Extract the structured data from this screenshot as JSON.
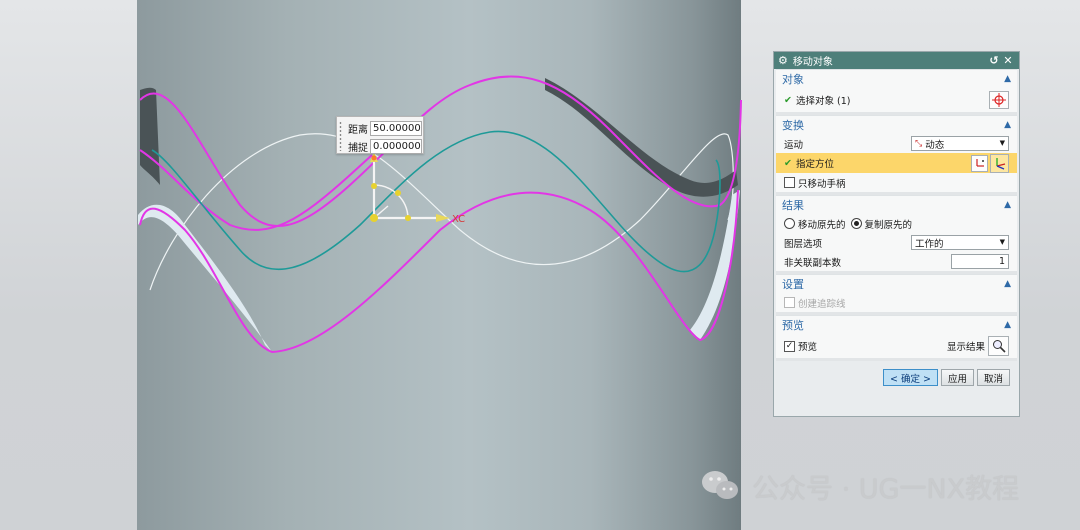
{
  "dynamic_input": {
    "distance_label": "距离",
    "distance_value": "50.000000",
    "snap_label": "捕捉",
    "snap_value": "0.000000"
  },
  "triad": {
    "axis_label": "XC"
  },
  "dialog": {
    "title": "移动对象",
    "sections": {
      "object": {
        "title": "对象",
        "select_label": "选择对象 (1)"
      },
      "transform": {
        "title": "变换",
        "motion_label": "运动",
        "motion_value": "动态",
        "specify_orientation_label": "指定方位",
        "move_handle_only_label": "只移动手柄"
      },
      "result": {
        "title": "结果",
        "move_original_label": "移动原先的",
        "copy_original_label": "复制原先的",
        "selected_option": "copy",
        "layer_option_label": "图层选项",
        "layer_option_value": "工作的",
        "nonassoc_copies_label": "非关联副本数",
        "nonassoc_copies_value": "1"
      },
      "settings": {
        "title": "设置",
        "create_trace_label": "创建追踪线"
      },
      "preview": {
        "title": "预览",
        "preview_label": "预览",
        "preview_checked": true,
        "show_result_label": "显示结果"
      }
    },
    "buttons": {
      "ok": "< 确定 >",
      "apply": "应用",
      "cancel": "取消"
    }
  },
  "watermark": {
    "text": "公众号 · UG一NX教程"
  },
  "colors": {
    "curve_magenta": "#e236e6",
    "curve_teal": "#1e9a98",
    "title_bar": "#4e7f7a",
    "section_title": "#2f6aa7",
    "highlight": "#fcd66a"
  }
}
